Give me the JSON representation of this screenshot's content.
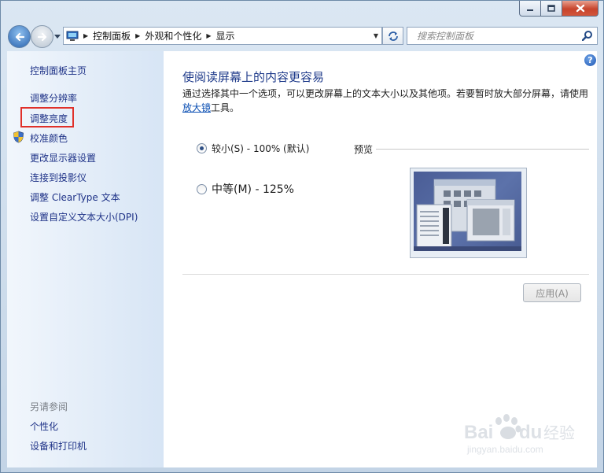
{
  "breadcrumb": [
    "控制面板",
    "外观和个性化",
    "显示"
  ],
  "search": {
    "placeholder": "搜索控制面板"
  },
  "sidebar": {
    "home": "控制面板主页",
    "links": [
      "调整分辨率",
      "调整亮度",
      "校准颜色",
      "更改显示器设置",
      "连接到投影仪",
      "调整 ClearType 文本",
      "设置自定义文本大小(DPI)"
    ],
    "see_also_title": "另请参阅",
    "see_also": [
      "个性化",
      "设备和打印机"
    ]
  },
  "main": {
    "title": "使阅读屏幕上的内容更容易",
    "description": "通过选择其中一个选项，可以更改屏幕上的文本大小以及其他项。若要暂时放大部分屏幕，请使用",
    "magnifier_link": "放大镜",
    "description_tail": "工具。",
    "options": [
      {
        "label": "较小(S) - 100% (默认)",
        "selected": true
      },
      {
        "label": "中等(M) - 125%",
        "selected": false
      }
    ],
    "preview_label": "预览",
    "apply_button": "应用(A)"
  },
  "watermark": {
    "line1": "Bai du 经验",
    "line2": "jingyan.baidu.com"
  },
  "icons": [
    "back-icon",
    "forward-icon",
    "control-panel-icon",
    "refresh-icon",
    "search-icon",
    "help-icon",
    "shield-icon"
  ],
  "colors": {
    "link": "#1e3287",
    "title": "#1e3a8a",
    "highlight_box": "#e0302a",
    "close_button": "#c7442c"
  }
}
